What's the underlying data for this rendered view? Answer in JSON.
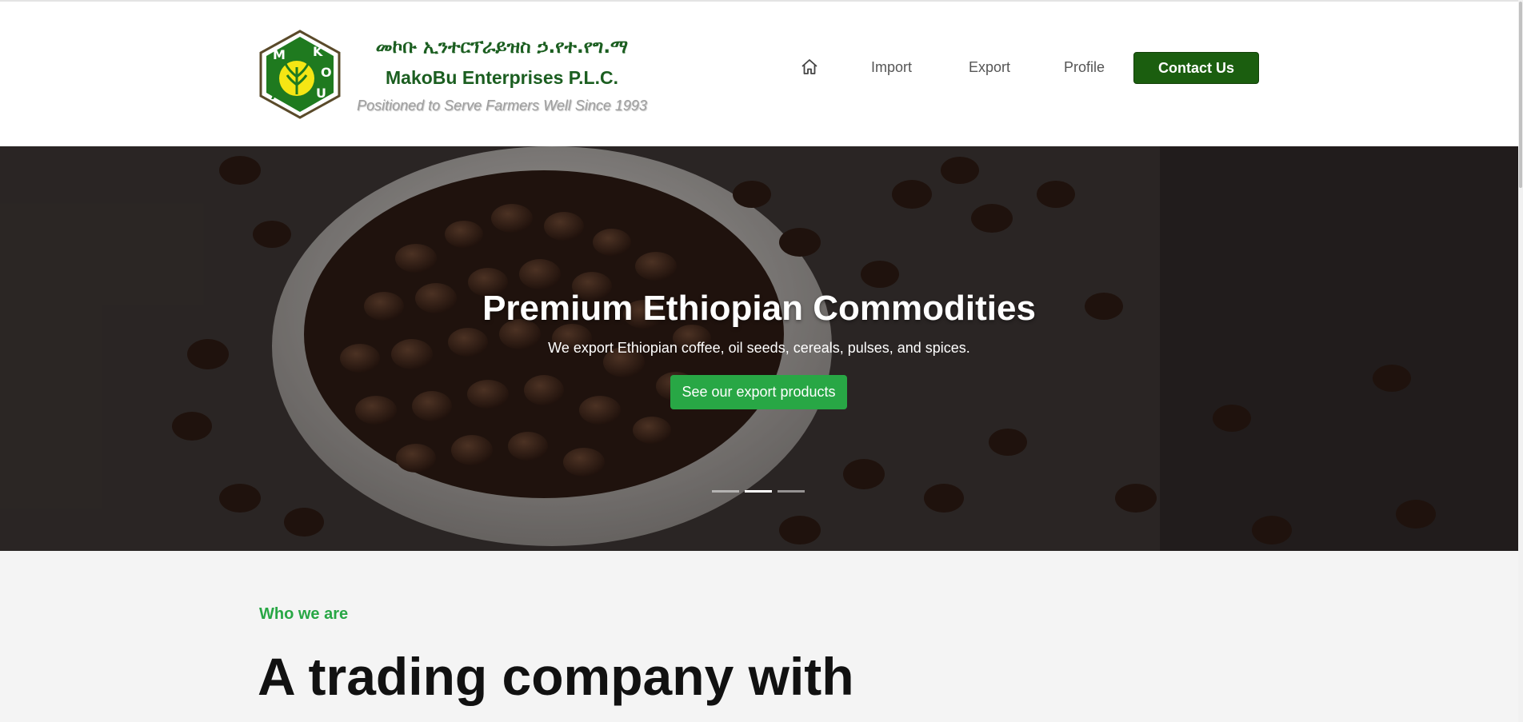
{
  "header": {
    "brand": {
      "amharic_name": "መኮቡ ኢንተርፕራይዝስ ኃ.የተ.የግ.ማ",
      "name": "MakoBu Enterprises P.L.C.",
      "tagline": "Positioned to Serve Farmers Well Since 1993",
      "logo_icon": "makobu-logo-icon"
    },
    "nav": {
      "home_icon": "home-icon",
      "import_label": "Import",
      "export_label": "Export",
      "profile_label": "Profile",
      "contact_label": "Contact Us"
    }
  },
  "hero": {
    "title": "Premium Ethiopian Commodities",
    "subtitle": "We export Ethiopian coffee, oil seeds, cereals, pulses, and spices.",
    "cta_label": "See our export products",
    "slide_count": 3,
    "active_slide": 2
  },
  "about": {
    "eyebrow": "Who we are",
    "title": "A trading company with"
  },
  "colors": {
    "brand_green": "#1b5e20",
    "accent_green": "#28a745",
    "logo_yellow": "#f5e614"
  }
}
